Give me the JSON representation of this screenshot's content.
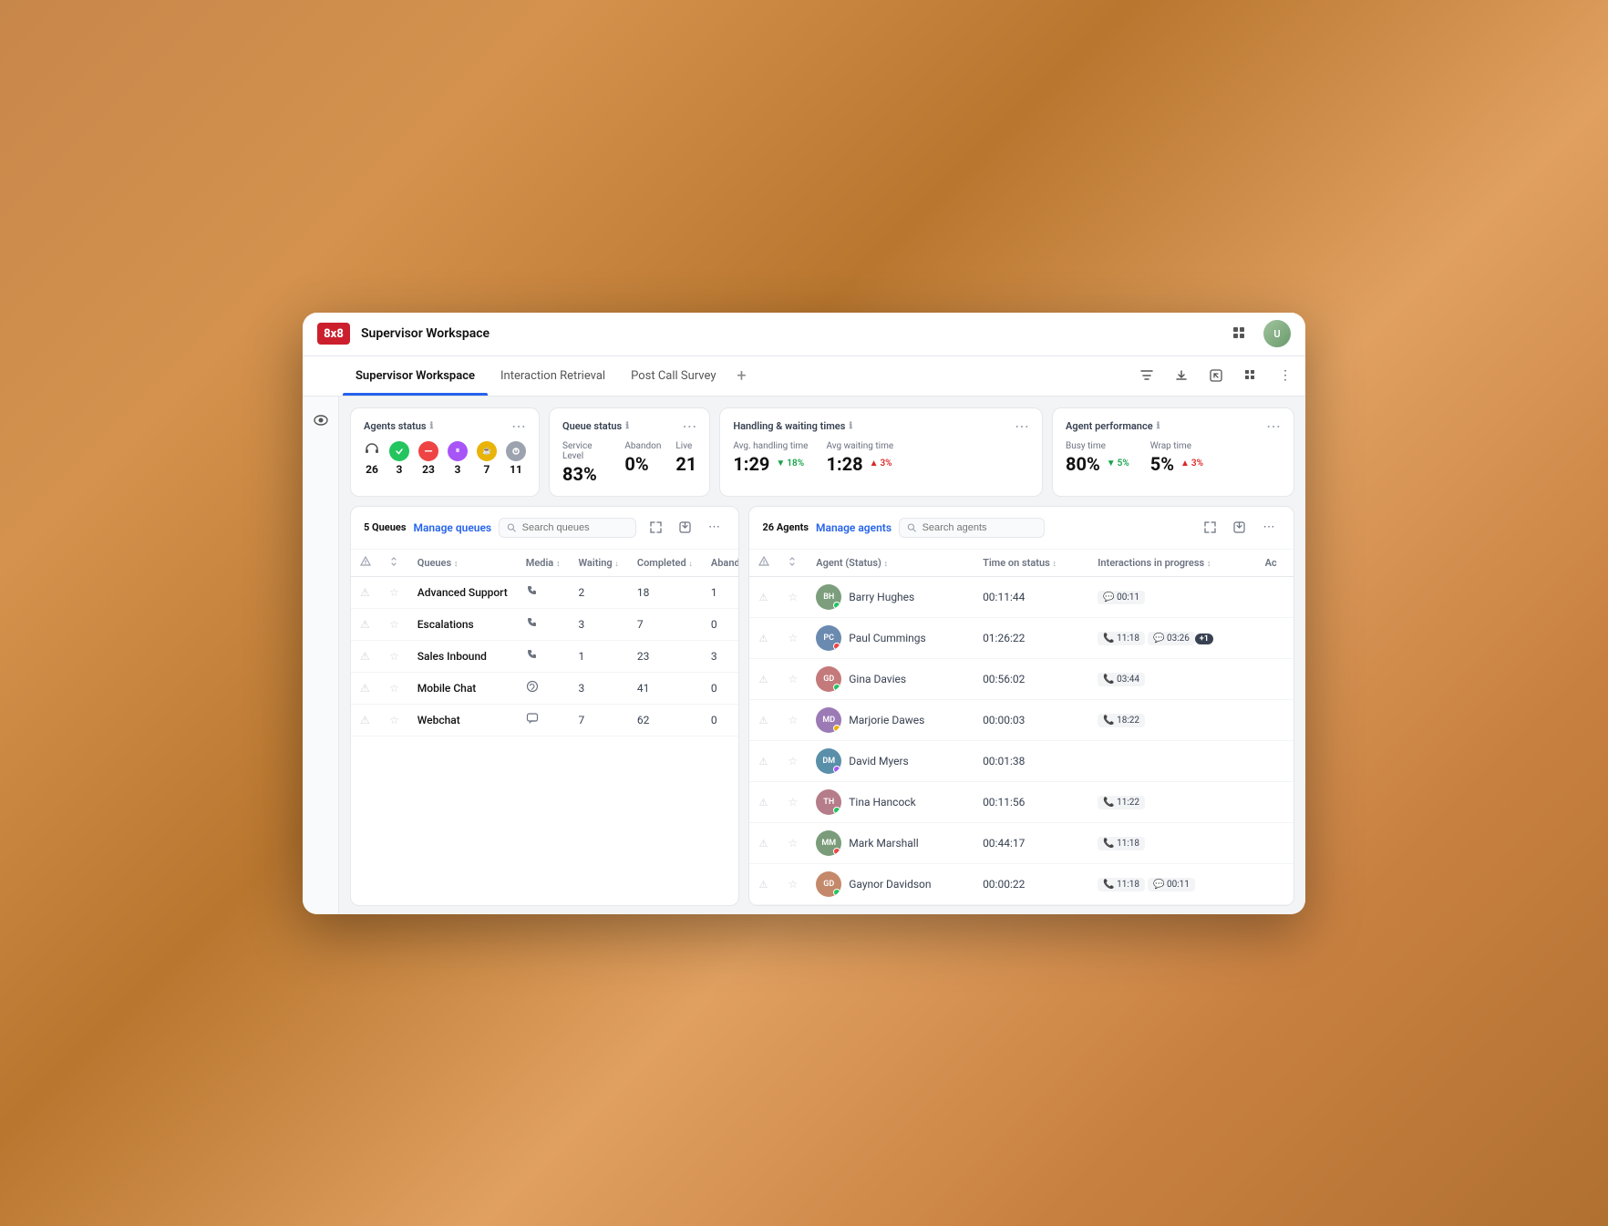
{
  "titleBar": {
    "logo": "8x8",
    "title": "Supervisor Workspace",
    "avatarInitials": "U"
  },
  "tabs": [
    {
      "label": "Supervisor Workspace",
      "active": true
    },
    {
      "label": "Interaction Retrieval",
      "active": false
    },
    {
      "label": "Post Call Survey",
      "active": false
    }
  ],
  "agentsStatus": {
    "title": "Agents status",
    "total": "26",
    "statuses": [
      {
        "color": "#22c55e",
        "count": "3",
        "type": "available"
      },
      {
        "color": "#ef4444",
        "count": "23",
        "type": "busy"
      },
      {
        "color": "#a855f7",
        "count": "3",
        "type": "away"
      },
      {
        "color": "#eab308",
        "count": "7",
        "type": "break"
      },
      {
        "color": "#6b7280",
        "count": "11",
        "type": "offline"
      }
    ]
  },
  "queueStatus": {
    "title": "Queue status",
    "serviceLevel": {
      "label": "Service Level",
      "value": "83%"
    },
    "abandon": {
      "label": "Abandon",
      "value": "0%"
    },
    "live": {
      "label": "Live",
      "value": "21"
    }
  },
  "handlingTimes": {
    "title": "Handling & waiting times",
    "avgHandling": {
      "label": "Avg. handling time",
      "value": "1:29",
      "trend": "18%",
      "trendDown": true
    },
    "avgWaiting": {
      "label": "Avg waiting time",
      "value": "1:28",
      "trend": "3%",
      "trendDown": false
    }
  },
  "agentPerformance": {
    "title": "Agent performance",
    "busyTime": {
      "label": "Busy time",
      "value": "80%",
      "trend": "5%",
      "trendDown": true
    },
    "wrapTime": {
      "label": "Wrap time",
      "value": "5%",
      "trend": "3%",
      "trendDown": false
    }
  },
  "queues": {
    "title": "5 Queues",
    "manageLabel": "Manage queues",
    "searchPlaceholder": "Search queues",
    "columns": [
      "",
      "",
      "Queues",
      "Media",
      "Waiting",
      "Completed",
      "Abandoned"
    ],
    "rows": [
      {
        "name": "Advanced Support",
        "media": "phone",
        "waiting": "2",
        "completed": "18",
        "abandoned": "1"
      },
      {
        "name": "Escalations",
        "media": "phone",
        "waiting": "3",
        "completed": "7",
        "abandoned": "0"
      },
      {
        "name": "Sales Inbound",
        "media": "phone",
        "waiting": "1",
        "completed": "23",
        "abandoned": "3"
      },
      {
        "name": "Mobile Chat",
        "media": "whatsapp",
        "waiting": "3",
        "completed": "41",
        "abandoned": "0"
      },
      {
        "name": "Webchat",
        "media": "chat",
        "waiting": "7",
        "completed": "62",
        "abandoned": "0"
      }
    ]
  },
  "agents": {
    "title": "26 Agents",
    "manageLabel": "Manage agents",
    "searchPlaceholder": "Search agents",
    "columns": [
      "",
      "",
      "Agent (Status)",
      "Time on status",
      "Interactions in progress",
      "Ac"
    ],
    "rows": [
      {
        "name": "Barry Hughes",
        "timeOnStatus": "00:11:44",
        "interactions": [
          {
            "icon": "💬",
            "time": "00:11"
          }
        ],
        "statusColor": "#22c55e",
        "avatarBg": "#7c9e7c"
      },
      {
        "name": "Paul Cummings",
        "timeOnStatus": "01:26:22",
        "interactions": [
          {
            "icon": "📞",
            "time": "11:18"
          },
          {
            "icon": "💬",
            "time": "03:26"
          }
        ],
        "extra": "+1",
        "statusColor": "#ef4444",
        "avatarBg": "#6b8ab0"
      },
      {
        "name": "Gina Davies",
        "timeOnStatus": "00:56:02",
        "interactions": [
          {
            "icon": "📞",
            "time": "03:44"
          }
        ],
        "statusColor": "#22c55e",
        "avatarBg": "#c47a7a"
      },
      {
        "name": "Marjorie Dawes",
        "timeOnStatus": "00:00:03",
        "interactions": [
          {
            "icon": "📞",
            "time": "18:22"
          }
        ],
        "statusColor": "#eab308",
        "avatarBg": "#9b7ab5"
      },
      {
        "name": "David Myers",
        "timeOnStatus": "00:01:38",
        "interactions": [],
        "statusColor": "#a855f7",
        "avatarBg": "#5a8faa"
      },
      {
        "name": "Tina Hancock",
        "timeOnStatus": "00:11:56",
        "interactions": [
          {
            "icon": "📞",
            "time": "11:22"
          }
        ],
        "statusColor": "#22c55e",
        "avatarBg": "#b57c8a"
      },
      {
        "name": "Mark Marshall",
        "timeOnStatus": "00:44:17",
        "interactions": [
          {
            "icon": "📞",
            "time": "11:18"
          }
        ],
        "statusColor": "#ef4444",
        "avatarBg": "#7a9c7a"
      },
      {
        "name": "Gaynor Davidson",
        "timeOnStatus": "00:00:22",
        "interactions": [
          {
            "icon": "📞",
            "time": "11:18"
          },
          {
            "icon": "💬",
            "time": "00:11"
          }
        ],
        "statusColor": "#22c55e",
        "avatarBg": "#c4896a"
      }
    ]
  }
}
